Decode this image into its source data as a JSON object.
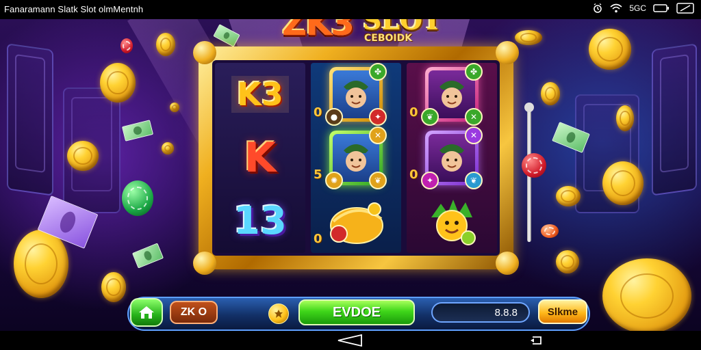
{
  "status_bar": {
    "title": "Fanaramann Slatk  Slot olmMentnh",
    "network": "5GC",
    "icons": [
      "alarm-icon",
      "wifi-icon",
      "network-label",
      "battery-icon",
      "screen-rotate-icon"
    ]
  },
  "logo": {
    "main": "ZK3",
    "slot": "SLOT",
    "sub": "CEBOIDK"
  },
  "reels": {
    "reel1": {
      "top": "K3",
      "middle": "K",
      "bottom": "13"
    },
    "reel2": {
      "side_numbers": [
        "0",
        "5",
        "0"
      ]
    },
    "reel3": {
      "side_numbers": [
        "0",
        "0"
      ]
    }
  },
  "controls": {
    "zk_label": "ZK O",
    "main_label": "EVDOE",
    "balance": "8.8.8",
    "share_label": "Slkme"
  },
  "nav": {
    "icons": [
      "back-icon",
      "recent-apps-icon"
    ]
  },
  "colors": {
    "accent_gold": "#ffc21a",
    "button_green": "#3fd61a",
    "frame_gold": "#f0b020",
    "bar_blue": "#123067"
  }
}
